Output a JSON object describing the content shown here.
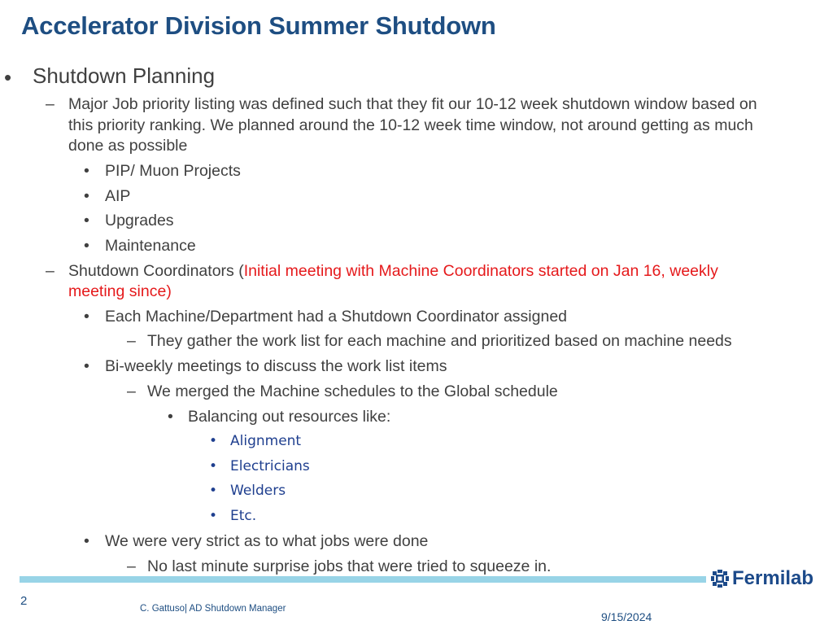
{
  "slide": {
    "title": "Accelerator Division Summer Shutdown",
    "heading": "Shutdown Planning",
    "bullet_glyph": "•",
    "dash_glyph": "–",
    "major_job": {
      "line1": "Major Job priority listing was defined such that they fit our 10-12 week shutdown window based on",
      "line2": "this priority ranking. We planned around the 10-12 week time window, not around getting as much",
      "line3": "done as possible"
    },
    "priorities": [
      "PIP/ Muon Projects",
      "AIP",
      "Upgrades",
      "Maintenance"
    ],
    "coordinators": {
      "label": "Shutdown Coordinators (",
      "highlight_line1": "Initial meeting with Machine Coordinators started on Jan 16, weekly",
      "highlight_line2": "meeting since)",
      "highlight_color": "#e5191b"
    },
    "each_machine": "Each Machine/Department had a Shutdown Coordinator assigned",
    "they_gather": "They gather the work list for each machine and prioritized based on machine needs",
    "biweekly": "Bi-weekly meetings to discuss the work list items",
    "merged": "We merged the Machine schedules to the Global schedule",
    "balancing": "Balancing out resources like:",
    "resources": [
      "Alignment",
      "Electricians",
      "Welders",
      "Etc."
    ],
    "strict": "We were very strict as to what jobs were done",
    "no_last_minute": "No last minute surprise jobs that were tried to squeeze in."
  },
  "footer": {
    "page_number": "2",
    "author": "C. Gattuso| AD Shutdown Manager",
    "date": "9/15/2024",
    "logo_text": "Fermilab",
    "bar_color": "#98d4e7",
    "brand_color": "#1e4e82"
  }
}
